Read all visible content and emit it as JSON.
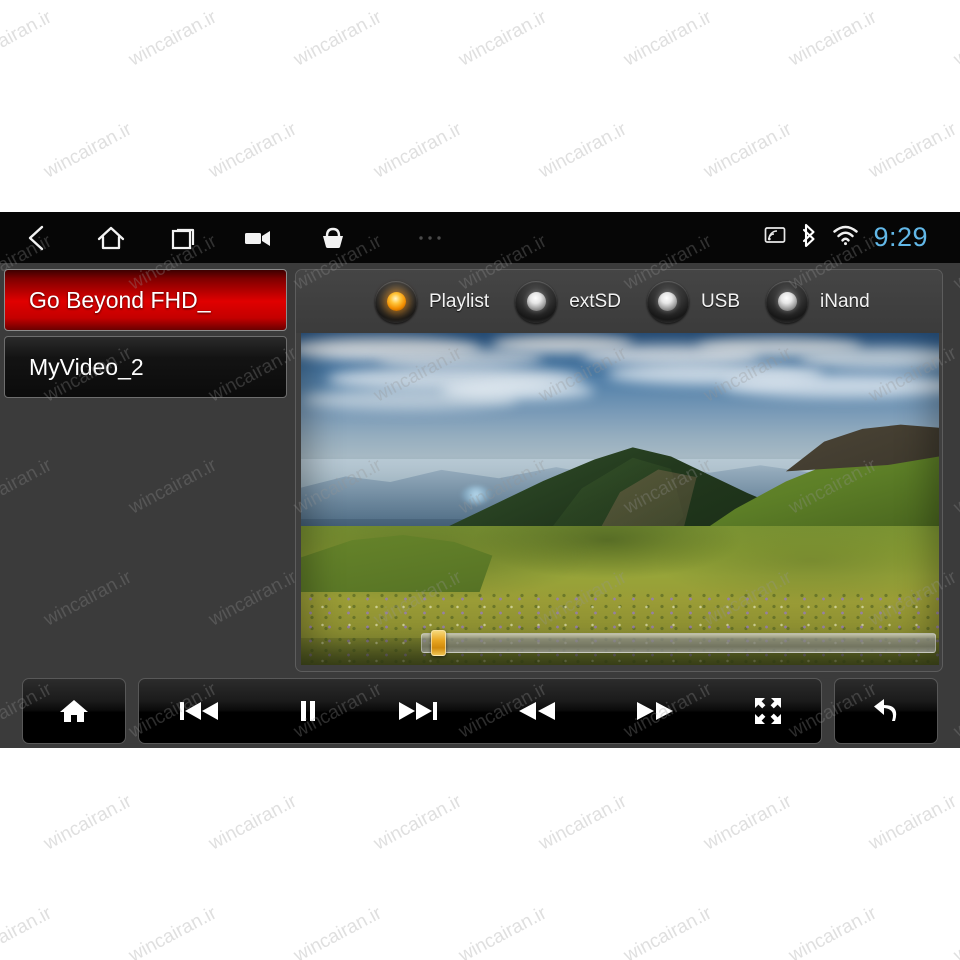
{
  "watermark": {
    "text": "wincairan.ir"
  },
  "status_bar": {
    "clock": "9:29",
    "clock_color": "#62b8e8",
    "nav_items": [
      {
        "name": "back-icon",
        "label": "Back"
      },
      {
        "name": "home-icon",
        "label": "Home"
      },
      {
        "name": "recents-icon",
        "label": "Recent apps"
      },
      {
        "name": "camera-icon",
        "label": "Camera"
      },
      {
        "name": "basket-icon",
        "label": "Apps"
      },
      {
        "name": "overflow-menu-icon",
        "label": "More"
      }
    ],
    "indicators": [
      {
        "name": "screencast-icon",
        "label": "Screen cast"
      },
      {
        "name": "bluetooth-icon",
        "label": "Bluetooth"
      },
      {
        "name": "wifi-icon",
        "label": "Wi-Fi"
      }
    ]
  },
  "playlist": {
    "items": [
      {
        "label": "Go Beyond FHD_",
        "selected": true
      },
      {
        "label": "MyVideo_2",
        "selected": false
      }
    ],
    "selected_color": "#e00000"
  },
  "sources": {
    "options": [
      {
        "label": "Playlist",
        "active": true
      },
      {
        "label": "extSD",
        "active": false
      },
      {
        "label": "USB",
        "active": false
      },
      {
        "label": "iNand",
        "active": false
      }
    ],
    "active_led_color": "#ffc53a",
    "inactive_led_color": "#e6e6e6"
  },
  "player": {
    "seek_percent": 2,
    "now_playing": "Go Beyond FHD_"
  },
  "controls": {
    "home": {
      "label": "Home",
      "icon": "home-icon"
    },
    "transport": [
      {
        "label": "Previous",
        "icon": "previous-track-icon"
      },
      {
        "label": "Pause",
        "icon": "pause-icon"
      },
      {
        "label": "Next",
        "icon": "next-track-icon"
      },
      {
        "label": "Rewind",
        "icon": "rewind-icon"
      },
      {
        "label": "Fast forward",
        "icon": "fast-forward-icon"
      },
      {
        "label": "Fullscreen",
        "icon": "fullscreen-icon"
      }
    ],
    "back": {
      "label": "Return",
      "icon": "return-arrow-icon"
    }
  }
}
